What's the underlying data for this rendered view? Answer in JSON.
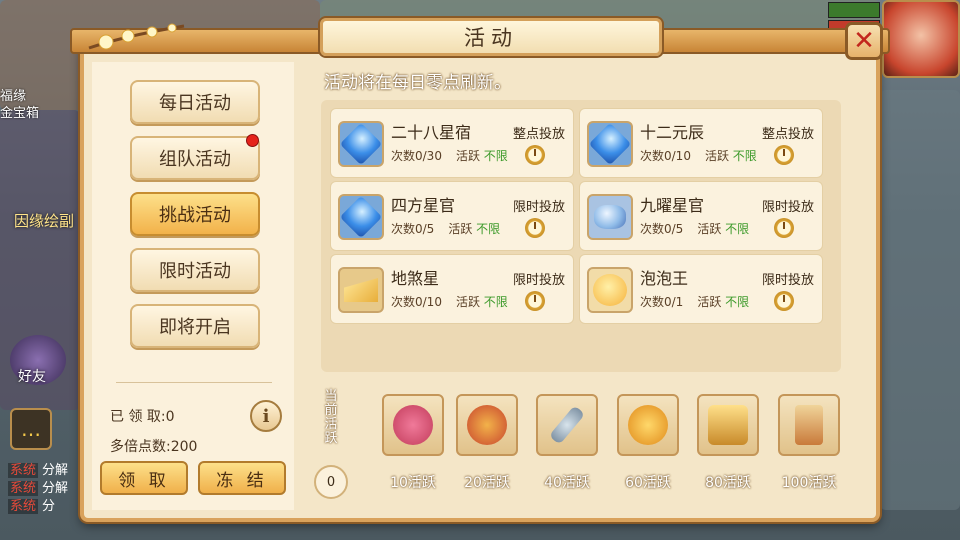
{
  "background": {
    "left_texts": [
      "福缘",
      "金宝箱"
    ],
    "left_caption": "因缘绘副",
    "friend_label": "好友",
    "chat": [
      {
        "tag": "系统",
        "text": "分解"
      },
      {
        "tag": "系统",
        "text": "分解"
      },
      {
        "tag": "系统",
        "text": "分"
      }
    ]
  },
  "header": {
    "title": "活动"
  },
  "sidebar": {
    "tabs": [
      {
        "label": "每日活动",
        "active": false
      },
      {
        "label": "组队活动",
        "active": false,
        "red_dot": true
      },
      {
        "label": "挑战活动",
        "active": true
      },
      {
        "label": "限时活动",
        "active": false
      },
      {
        "label": "即将开启",
        "active": false
      }
    ],
    "received": "已 领 取:0",
    "multiplier": "多倍点数:200",
    "info_glyph": "i",
    "claim_label": "领 取",
    "freeze_label": "冻 结"
  },
  "notice": "活动将在每日零点刷新。",
  "activities": [
    {
      "name": "二十八星宿",
      "count": "次数0/30",
      "act": "活跃",
      "act_value": "不限",
      "mode": "整点投放",
      "icon": "blue-gem-icon"
    },
    {
      "name": "十二元辰",
      "count": "次数0/10",
      "act": "活跃",
      "act_value": "不限",
      "mode": "整点投放",
      "icon": "blue-gem-icon"
    },
    {
      "name": "四方星官",
      "count": "次数0/5",
      "act": "活跃",
      "act_value": "不限",
      "mode": "限时投放",
      "icon": "blue-gem-icon"
    },
    {
      "name": "九曜星官",
      "count": "次数0/5",
      "act": "活跃",
      "act_value": "不限",
      "mode": "限时投放",
      "icon": "crystal-bowl-icon"
    },
    {
      "name": "地煞星",
      "count": "次数0/10",
      "act": "活跃",
      "act_value": "不限",
      "mode": "限时投放",
      "icon": "cheese-icon"
    },
    {
      "name": "泡泡王",
      "count": "次数0/1",
      "act": "活跃",
      "act_value": "不限",
      "mode": "限时投放",
      "icon": "bubble-face-icon"
    }
  ],
  "activity_bar": {
    "label": "当前活跃",
    "current": "0",
    "rewards": [
      {
        "label": "10活跃",
        "icon": "dragon-icon"
      },
      {
        "label": "20活跃",
        "icon": "treasure-bag-icon"
      },
      {
        "label": "40活跃",
        "icon": "key-icon"
      },
      {
        "label": "60活跃",
        "icon": "money-bag-icon"
      },
      {
        "label": "80活跃",
        "icon": "treasure-chest-icon"
      },
      {
        "label": "100活跃",
        "icon": "scroll-icon"
      }
    ]
  },
  "colors": {
    "accent": "#f2b24a",
    "panel": "#f4e6c8",
    "unlimited": "#3c9a2a",
    "badge": "#e5231b"
  }
}
